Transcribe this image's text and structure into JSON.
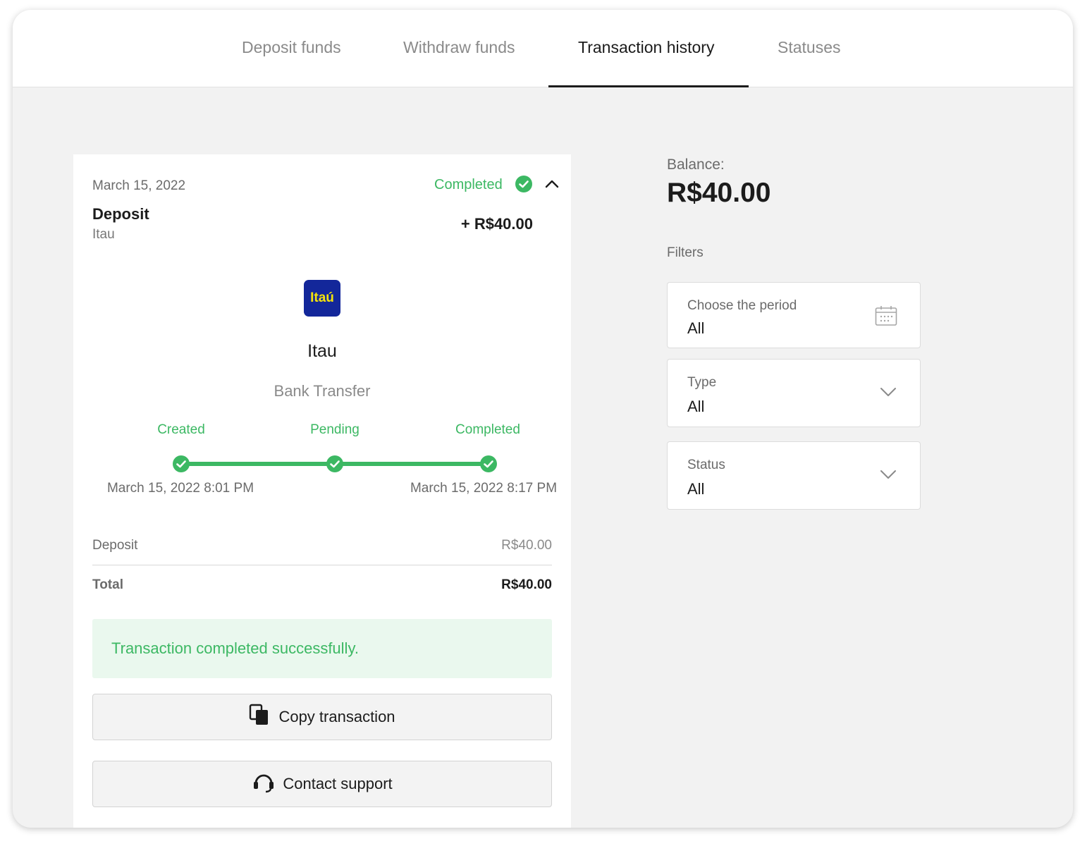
{
  "tabs": [
    {
      "label": "Deposit funds",
      "active": false
    },
    {
      "label": "Withdraw funds",
      "active": false
    },
    {
      "label": "Transaction history",
      "active": true
    },
    {
      "label": "Statuses",
      "active": false
    }
  ],
  "transaction": {
    "date": "March 15, 2022",
    "status": "Completed",
    "type": "Deposit",
    "provider": "Itau",
    "amount": "+ R$40.00",
    "logo_text": "Itaú",
    "bank_name": "Itau",
    "method": "Bank Transfer",
    "steps": [
      {
        "label": "Created",
        "time": "March 15, 2022 8:01 PM"
      },
      {
        "label": "Pending",
        "time": ""
      },
      {
        "label": "Completed",
        "time": "March 15, 2022 8:17 PM"
      }
    ],
    "breakdown": {
      "deposit_label": "Deposit",
      "deposit_value": "R$40.00",
      "total_label": "Total",
      "total_value": "R$40.00"
    },
    "success_message": "Transaction completed successfully.",
    "copy_label": "Copy transaction",
    "support_label": "Contact support"
  },
  "balance": {
    "label": "Balance:",
    "value": "R$40.00"
  },
  "filters": {
    "title": "Filters",
    "period": {
      "caption": "Choose the period",
      "value": "All"
    },
    "type": {
      "caption": "Type",
      "value": "All"
    },
    "status": {
      "caption": "Status",
      "value": "All"
    }
  },
  "colors": {
    "accent_green": "#3cb863",
    "success_bg": "#eaf8ee",
    "itau_blue": "#13279a",
    "itau_yellow": "#f5e40a"
  },
  "icons": [
    "check-circle-icon",
    "chevron-up-icon",
    "calendar-icon",
    "chevron-down-icon",
    "copy-icon",
    "headset-icon"
  ]
}
